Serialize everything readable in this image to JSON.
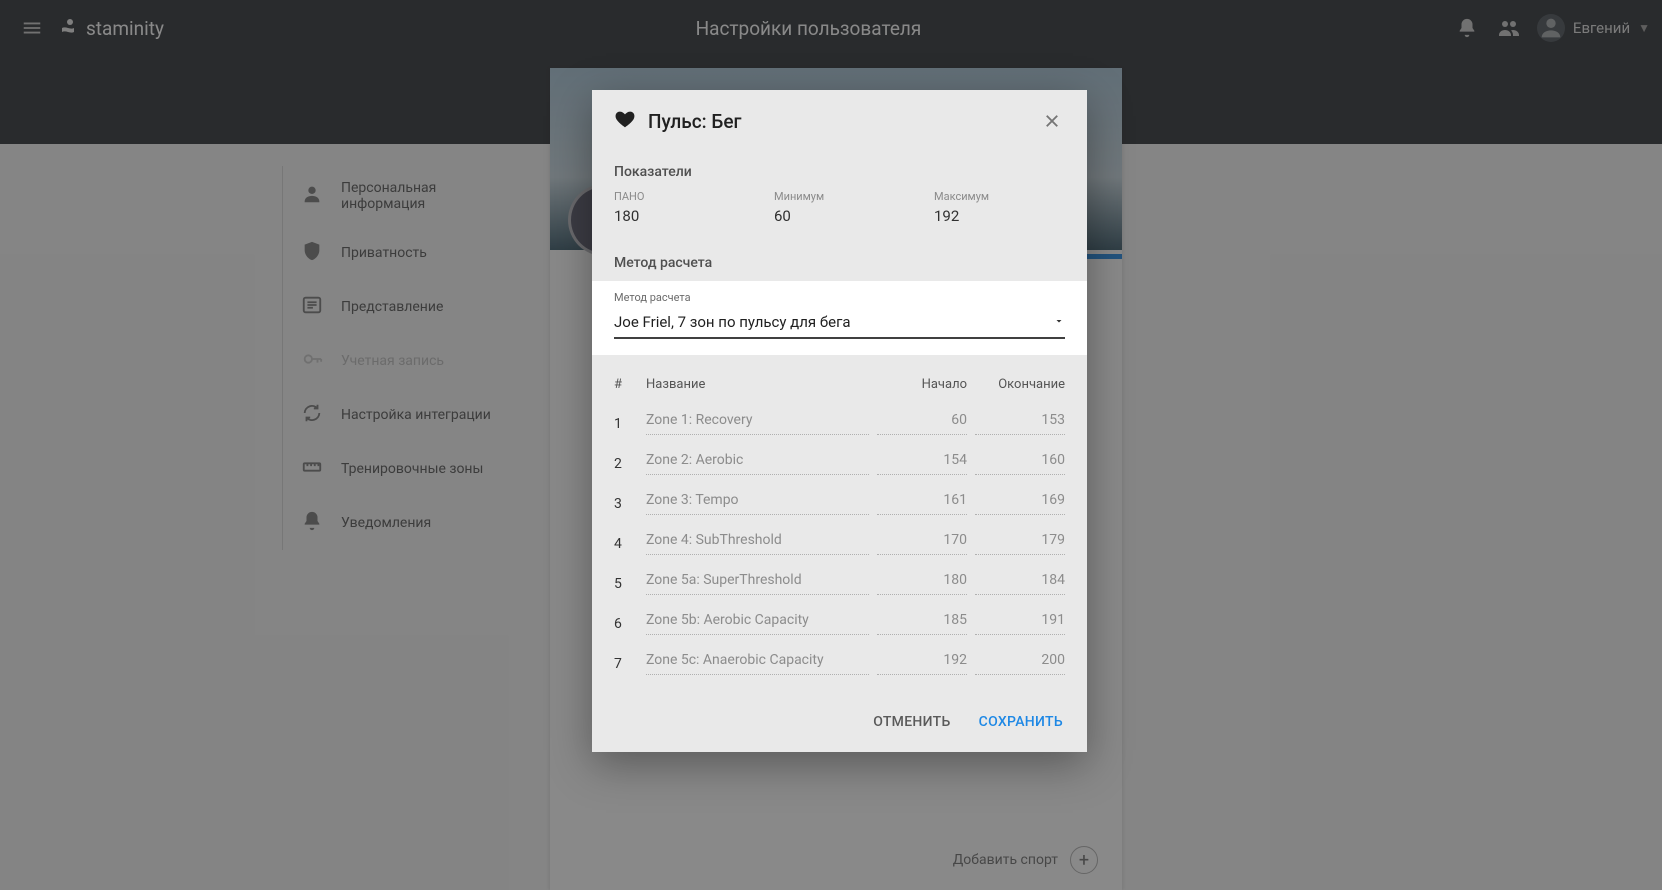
{
  "header": {
    "brand": "staminity",
    "page_title": "Настройки пользователя",
    "username": "Евгений"
  },
  "sidebar": {
    "items": [
      {
        "icon": "person",
        "label": "Персональная информация"
      },
      {
        "icon": "shield",
        "label": "Приватность"
      },
      {
        "icon": "list",
        "label": "Представление"
      },
      {
        "icon": "key",
        "label": "Учетная запись",
        "disabled": true
      },
      {
        "icon": "sync",
        "label": "Настройка интеграции"
      },
      {
        "icon": "ruler",
        "label": "Тренировочные зоны"
      },
      {
        "icon": "bell",
        "label": "Уведомления"
      }
    ]
  },
  "bg_card": {
    "add_sport": "Добавить спорт"
  },
  "modal": {
    "title": "Пульс: Бег",
    "sections": {
      "metrics_title": "Показатели",
      "method_title": "Метод расчета"
    },
    "metrics": {
      "pano_label": "ПАНО",
      "pano_value": "180",
      "min_label": "Минимум",
      "min_value": "60",
      "max_label": "Максимум",
      "max_value": "192"
    },
    "method": {
      "label": "Метод расчета",
      "value": "Joe Friel, 7 зон по пульсу для бега"
    },
    "table": {
      "head_index": "#",
      "head_name": "Название",
      "head_start": "Начало",
      "head_end": "Окончание",
      "rows": [
        {
          "idx": "1",
          "name": "Zone 1: Recovery",
          "start": "60",
          "end": "153"
        },
        {
          "idx": "2",
          "name": "Zone 2: Aerobic",
          "start": "154",
          "end": "160"
        },
        {
          "idx": "3",
          "name": "Zone 3: Tempo",
          "start": "161",
          "end": "169"
        },
        {
          "idx": "4",
          "name": "Zone 4: SubThreshold",
          "start": "170",
          "end": "179"
        },
        {
          "idx": "5",
          "name": "Zone 5a: SuperThreshold",
          "start": "180",
          "end": "184"
        },
        {
          "idx": "6",
          "name": "Zone 5b: Aerobic Capacity",
          "start": "185",
          "end": "191"
        },
        {
          "idx": "7",
          "name": "Zone 5c: Anaerobic Capacity",
          "start": "192",
          "end": "200"
        }
      ]
    },
    "actions": {
      "cancel": "ОТМЕНИТЬ",
      "save": "СОХРАНИТЬ"
    }
  }
}
